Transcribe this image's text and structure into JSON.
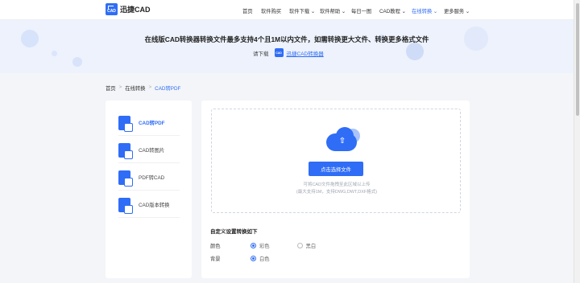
{
  "header": {
    "logo_text": "迅捷CAD",
    "logo_badge": "CAD",
    "nav": [
      {
        "label": "首页",
        "active": false
      },
      {
        "label": "软件购买",
        "active": false
      },
      {
        "label": "软件下载",
        "active": false
      },
      {
        "label": "软件帮助",
        "active": false
      },
      {
        "label": "每日一图",
        "active": false
      },
      {
        "label": "CAD教程",
        "active": false
      },
      {
        "label": "在线转换",
        "active": true
      },
      {
        "label": "更多服务",
        "active": false
      }
    ]
  },
  "banner": {
    "title": "在线版CAD转换器转换文件最多支持4个且1M以内文件，如需转换更大文件、转换更多格式文件",
    "sub_prefix": "请下载",
    "mini_logo": "CAD",
    "link": "迅捷CAD转换器"
  },
  "breadcrumb": {
    "home": "首页",
    "section": "在线转换",
    "current": "CAD转PDF",
    "separator": ">"
  },
  "sidebar": {
    "items": [
      {
        "label": "CAD转PDF",
        "active": true
      },
      {
        "label": "CAD转图片",
        "active": false
      },
      {
        "label": "PDF转CAD",
        "active": false
      },
      {
        "label": "CAD版本转换",
        "active": false
      }
    ]
  },
  "upload": {
    "button": "点击选择文件",
    "hint1": "可将CAD文件拖拽至此区域以上传",
    "hint2": "(最大支持1M，支持DWG,DWT,DXF格式)"
  },
  "settings": {
    "title": "自定义设置转换如下",
    "color_label": "颜色",
    "color_options": [
      {
        "label": "彩色",
        "checked": true
      },
      {
        "label": "黑白",
        "checked": false
      }
    ],
    "background_label": "背景",
    "background_options": [
      {
        "label": "白色",
        "checked": true
      }
    ]
  },
  "icons": {
    "accent": "#2f6df6"
  }
}
